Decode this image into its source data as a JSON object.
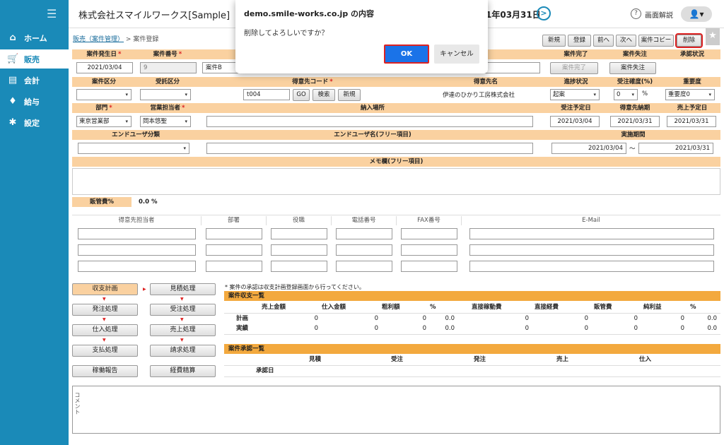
{
  "sidebar": {
    "items": [
      {
        "label": "ホーム",
        "icon": "home-icon",
        "glyph": "⌂"
      },
      {
        "label": "販売",
        "icon": "cart-icon",
        "glyph": "🛒"
      },
      {
        "label": "会計",
        "icon": "calculator-icon",
        "glyph": "▤"
      },
      {
        "label": "給与",
        "icon": "money-bag-icon",
        "glyph": "♦"
      },
      {
        "label": "設定",
        "icon": "gear-icon",
        "glyph": "✱"
      }
    ]
  },
  "header": {
    "company": "株式会社スマイルワークス[Sample]",
    "date": "1年03月31日",
    "help_label": "画面解説"
  },
  "breadcrumb": {
    "link": "販売（案件管理）",
    "separator": ">",
    "current": "案件登録"
  },
  "actions": {
    "new": "新規",
    "register": "登録",
    "prev": "前へ",
    "next": "次へ",
    "copy": "案件コピー",
    "delete": "削除"
  },
  "form": {
    "labels": {
      "occur_date": "案件発生日",
      "case_no": "案件番号",
      "case_done": "案件完了",
      "case_lost": "案件失注",
      "approval": "承認状況",
      "category": "案件区分",
      "order_type": "受託区分",
      "client_code": "得意先コード",
      "client_name": "得意先名",
      "progress": "進捗状況",
      "certainty": "受注確度(%)",
      "importance": "重要度",
      "dept": "部門",
      "sales_rep": "営業担当者",
      "delivery_place": "納入場所",
      "order_plan": "受注予定日",
      "client_due": "得意先納期",
      "sales_plan": "売上予定日",
      "enduser_cat": "エンドユーザ分類",
      "enduser_name": "エンドユーザ名(フリー項目)",
      "period": "実施期間",
      "memo": "メモ欄(フリー項目)",
      "admin_cost": "販管費%"
    },
    "values": {
      "occur_date": "2021/03/04",
      "case_no": "9",
      "case_name": "案件B",
      "case_done_btn": "案件完了",
      "case_lost_btn": "案件失注",
      "client_code": "t004",
      "go_btn": "GO",
      "search_btn": "検索",
      "new_btn": "新規",
      "client_name": "伊達のひかり工房株式会社",
      "progress": "起案",
      "certainty": "0",
      "certainty_unit": "%",
      "importance": "重要度0",
      "dept": "東京営業部",
      "sales_rep": "岡本悠聖",
      "order_plan": "2021/03/04",
      "client_due": "2021/03/31",
      "sales_plan": "2021/03/31",
      "period_from": "2021/03/04",
      "period_sep": "～",
      "period_to": "2021/03/31",
      "admin_cost": "0.0 %"
    }
  },
  "contacts": {
    "headers": [
      "得意先担当者",
      "部署",
      "役職",
      "電話番号",
      "FAX番号",
      "E-Mail"
    ]
  },
  "process": {
    "buttons": [
      "収支計画",
      "見積処理",
      "発注処理",
      "受注処理",
      "仕入処理",
      "売上処理",
      "支払処理",
      "請求処理",
      "稼働報告",
      "経費精算"
    ],
    "note": "* 案件の承認は収支計画登録画面から行ってください。"
  },
  "summary": {
    "title": "案件収支一覧",
    "headers": [
      "売上金額",
      "仕入金額",
      "粗利額",
      "%",
      "直接稼動費",
      "直接経費",
      "販管費",
      "純利益",
      "%"
    ],
    "rows": [
      {
        "label": "計画",
        "values": [
          "0",
          "0",
          "0",
          "0.0",
          "0",
          "0",
          "0",
          "0",
          "0.0"
        ]
      },
      {
        "label": "実績",
        "values": [
          "0",
          "0",
          "0",
          "0.0",
          "0",
          "0",
          "0",
          "0",
          "0.0"
        ]
      }
    ]
  },
  "approval": {
    "title": "案件承認一覧",
    "headers": [
      "見積",
      "受注",
      "発注",
      "売上",
      "仕入"
    ],
    "row_label": "承認日"
  },
  "comment": {
    "label": "コメント"
  },
  "dialog": {
    "title": "demo.smile-works.co.jp の内容",
    "message": "削除してよろしいですか？",
    "ok": "OK",
    "cancel": "キャンセル"
  }
}
